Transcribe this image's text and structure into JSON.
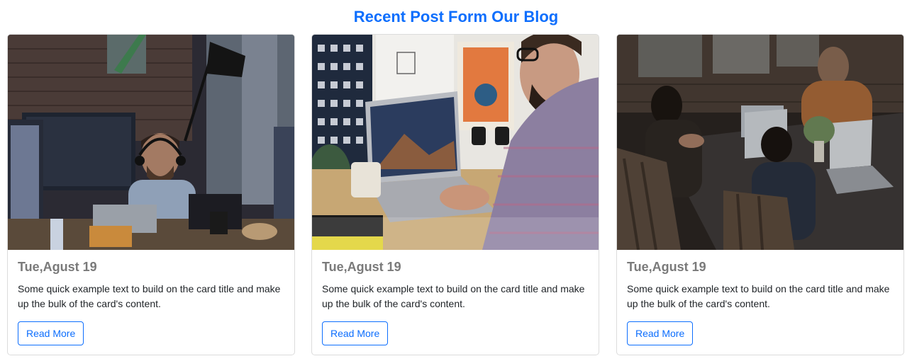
{
  "section": {
    "title": "Recent Post Form Our Blog"
  },
  "cards": [
    {
      "image": "office-man-headset-photo",
      "date": "Tue,Agust 19",
      "text": "Some quick example text to build on the card title and make up the bulk of the card's content.",
      "button": "Read More"
    },
    {
      "image": "laptop-desk-photo",
      "date": "Tue,Agust 19",
      "text": "Some quick example text to build on the card title and make up the bulk of the card's content.",
      "button": "Read More"
    },
    {
      "image": "team-meeting-photo",
      "date": "Tue,Agust 19",
      "text": "Some quick example text to build on the card title and make up the bulk of the card's content.",
      "button": "Read More"
    }
  ],
  "colors": {
    "accent": "#0d6efd",
    "date_text": "#7a7a7a",
    "body_text": "#212529",
    "card_border": "#dcdcdc"
  }
}
